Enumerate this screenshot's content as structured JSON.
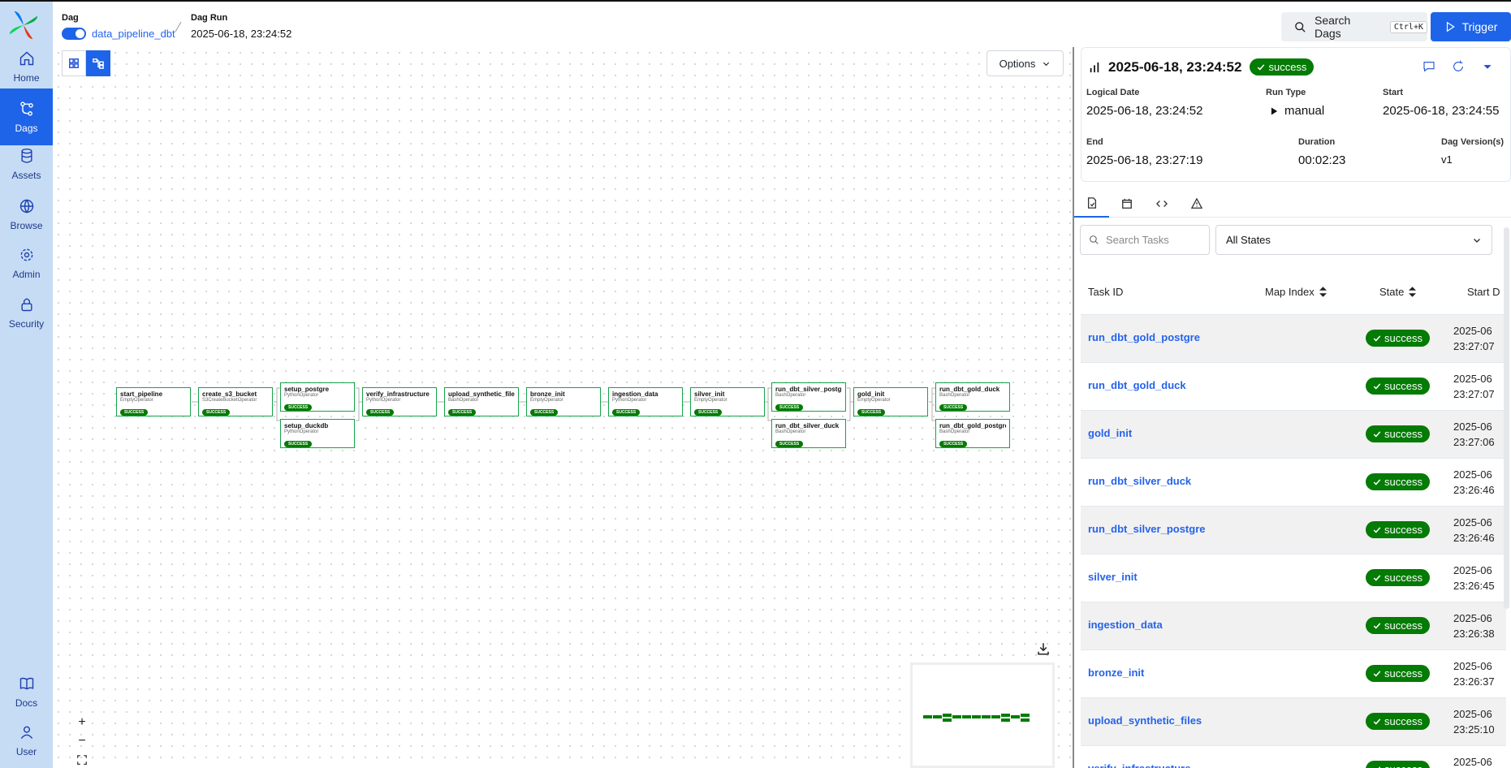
{
  "sidebar": {
    "items": [
      {
        "label": "Home",
        "icon": "home-icon"
      },
      {
        "label": "Dags",
        "icon": "dags-icon"
      },
      {
        "label": "Assets",
        "icon": "database-icon"
      },
      {
        "label": "Browse",
        "icon": "globe-icon"
      },
      {
        "label": "Admin",
        "icon": "gear-icon"
      },
      {
        "label": "Security",
        "icon": "lock-icon"
      }
    ],
    "bottom_items": [
      {
        "label": "Docs",
        "icon": "book-icon"
      },
      {
        "label": "User",
        "icon": "user-icon"
      }
    ]
  },
  "header": {
    "dag_label": "Dag",
    "dag_name": "data_pipeline_dbt",
    "run_label": "Dag Run",
    "run_value": "2025-06-18, 23:24:52",
    "search_label": "Search Dags",
    "search_shortcut": "Ctrl+K",
    "trigger_label": "Trigger"
  },
  "graph": {
    "options_label": "Options",
    "nodes": [
      {
        "name": "start_pipeline",
        "operator": "EmptyOperator",
        "state": "success"
      },
      {
        "name": "create_s3_bucket",
        "operator": "S3CreateBucketOperator",
        "state": "success"
      },
      {
        "name": "setup_postgre",
        "operator": "PythonOperator",
        "state": "success"
      },
      {
        "name": "setup_duckdb",
        "operator": "PythonOperator",
        "state": "success"
      },
      {
        "name": "verify_infrastructure",
        "operator": "PythonOperator",
        "state": "success"
      },
      {
        "name": "upload_synthetic_files",
        "operator": "BashOperator",
        "state": "success"
      },
      {
        "name": "bronze_init",
        "operator": "EmptyOperator",
        "state": "success"
      },
      {
        "name": "ingestion_data",
        "operator": "PythonOperator",
        "state": "success"
      },
      {
        "name": "silver_init",
        "operator": "EmptyOperator",
        "state": "success"
      },
      {
        "name": "run_dbt_silver_postgre",
        "operator": "BashOperator",
        "state": "success"
      },
      {
        "name": "run_dbt_silver_duck",
        "operator": "BashOperator",
        "state": "success"
      },
      {
        "name": "gold_init",
        "operator": "EmptyOperator",
        "state": "success"
      },
      {
        "name": "run_dbt_gold_duck",
        "operator": "BashOperator",
        "state": "success"
      },
      {
        "name": "run_dbt_gold_postgre",
        "operator": "BashOperator",
        "state": "success"
      }
    ],
    "zoom_in": "+",
    "zoom_out": "−"
  },
  "run": {
    "title": "2025-06-18, 23:24:52",
    "state": "success",
    "logical_date_label": "Logical Date",
    "logical_date": "2025-06-18, 23:24:52",
    "run_type_label": "Run Type",
    "run_type": "manual",
    "start_label": "Start",
    "start": "2025-06-18, 23:24:55",
    "end_label": "End",
    "end": "2025-06-18, 23:27:19",
    "duration_label": "Duration",
    "duration": "00:02:23",
    "version_label": "Dag Version(s)",
    "version": "v1"
  },
  "tasks": {
    "search_placeholder": "Search Tasks",
    "state_filter": "All States",
    "columns": {
      "task_id": "Task ID",
      "map_index": "Map Index",
      "state": "State",
      "start": "Start D"
    },
    "rows": [
      {
        "task_id": "run_dbt_gold_postgre",
        "state": "success",
        "start_l1": "2025-06",
        "start_l2": "23:27:07"
      },
      {
        "task_id": "run_dbt_gold_duck",
        "state": "success",
        "start_l1": "2025-06",
        "start_l2": "23:27:07"
      },
      {
        "task_id": "gold_init",
        "state": "success",
        "start_l1": "2025-06",
        "start_l2": "23:27:06"
      },
      {
        "task_id": "run_dbt_silver_duck",
        "state": "success",
        "start_l1": "2025-06",
        "start_l2": "23:26:46"
      },
      {
        "task_id": "run_dbt_silver_postgre",
        "state": "success",
        "start_l1": "2025-06",
        "start_l2": "23:26:46"
      },
      {
        "task_id": "silver_init",
        "state": "success",
        "start_l1": "2025-06",
        "start_l2": "23:26:45"
      },
      {
        "task_id": "ingestion_data",
        "state": "success",
        "start_l1": "2025-06",
        "start_l2": "23:26:38"
      },
      {
        "task_id": "bronze_init",
        "state": "success",
        "start_l1": "2025-06",
        "start_l2": "23:26:37"
      },
      {
        "task_id": "upload_synthetic_files",
        "state": "success",
        "start_l1": "2025-06",
        "start_l2": "23:25:10"
      },
      {
        "task_id": "verify_infrastructure",
        "state": "success",
        "start_l1": "2025-06",
        "start_l2": ""
      }
    ]
  },
  "colors": {
    "accent": "#1d64e8",
    "success": "#047b04",
    "sidebar": "#c6dcf5"
  }
}
